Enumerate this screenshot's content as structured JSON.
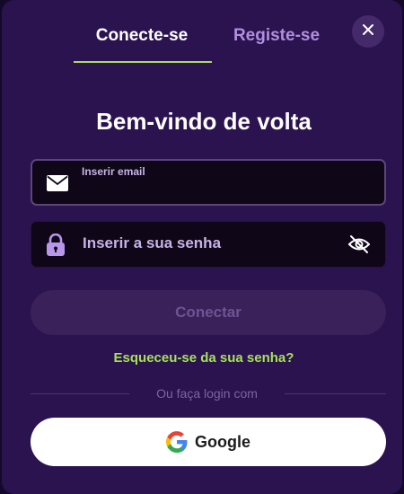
{
  "tabs": {
    "login_label": "Conecte-se",
    "register_label": "Registe-se"
  },
  "title": "Bem-vindo de volta",
  "email_field": {
    "label": "Inserir email",
    "value": ""
  },
  "password_field": {
    "placeholder": "Inserir a sua senha",
    "value": ""
  },
  "connect_button": "Conectar",
  "forgot_link": "Esqueceu-se da sua senha?",
  "divider_text": "Ou faça login com",
  "google_button": "Google",
  "icons": {
    "close": "close-icon",
    "email": "envelope-icon",
    "password": "lock-icon",
    "visibility": "eye-off-icon",
    "google": "google-g-icon"
  },
  "colors": {
    "background": "#2b1350",
    "accent": "#a6e05a",
    "inactive_tab": "#b08fde",
    "field_background": "#0f0618",
    "disabled_button": "#3a2159",
    "disabled_button_text": "#6e5493"
  }
}
